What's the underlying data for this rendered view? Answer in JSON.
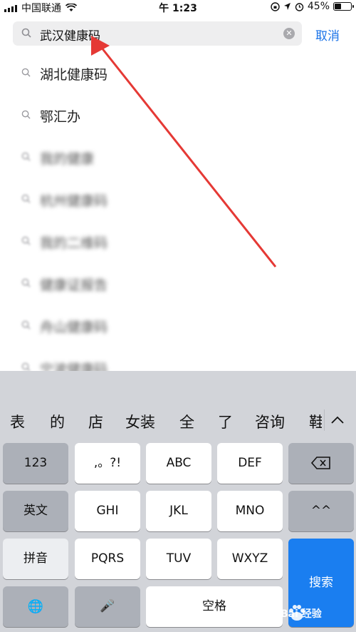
{
  "status_bar": {
    "carrier": "中国联通",
    "time": "午 1:23",
    "battery_percent": "45%",
    "battery_level": 0.45
  },
  "search": {
    "query": "武汉健康码",
    "cancel_label": "取消"
  },
  "suggestions": [
    {
      "label": "湖北健康码",
      "blurred": false
    },
    {
      "label": "鄂汇办",
      "blurred": false
    },
    {
      "label": "我的健康",
      "blurred": true
    },
    {
      "label": "杭州健康码",
      "blurred": true
    },
    {
      "label": "我的二维码",
      "blurred": true
    },
    {
      "label": "健康证报告",
      "blurred": true
    },
    {
      "label": "舟山健康码",
      "blurred": true
    },
    {
      "label": "宁波健康码",
      "blurred": true
    }
  ],
  "keyboard": {
    "candidates": [
      "表",
      "的",
      "店",
      "女装",
      "全",
      "了",
      "咨询",
      "鞋"
    ],
    "collapse_icon": "chevron-up",
    "rows": [
      [
        "123",
        ",。?!",
        "ABC",
        "DEF",
        "⌫"
      ],
      [
        "英文",
        "GHI",
        "JKL",
        "MNO",
        "^^"
      ],
      [
        "拼音",
        "PQRS",
        "TUV",
        "WXYZ"
      ],
      [
        "🌐",
        "🎤",
        "空格"
      ]
    ],
    "search_key": "搜索"
  },
  "watermark": "Bai 经验",
  "colors": {
    "accent": "#1a7ef0",
    "cancel": "#1a73e8",
    "arrow": "#e53935"
  }
}
